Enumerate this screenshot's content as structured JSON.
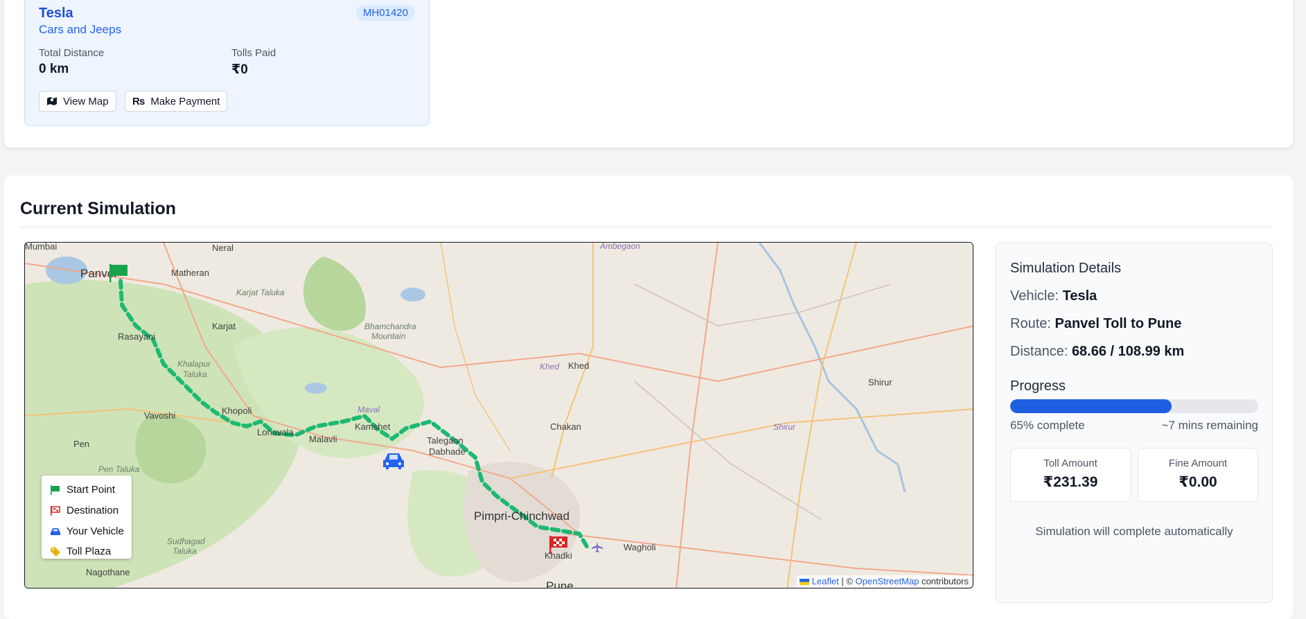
{
  "vehicle_card": {
    "name": "Tesla",
    "type": "Cars and Jeeps",
    "plate": "MH01420",
    "distance_label": "Total Distance",
    "distance_value": "0 km",
    "tolls_label": "Tolls Paid",
    "tolls_value": "₹0",
    "view_map_label": "View Map",
    "make_payment_label": "Make Payment",
    "payment_icon_text": "₨"
  },
  "simulation": {
    "title": "Current Simulation",
    "map": {
      "places": {
        "mumbai": "Mumbai",
        "panvel": "Panvel",
        "neral": "Neral",
        "matheran": "Matheran",
        "karjat_taluka": "Karjat Taluka",
        "karjat": "Karjat",
        "rasayani": "Rasayani",
        "bhamchandra": "Bhamchandra",
        "mountain": "Mountain",
        "khalapur": "Khalapur",
        "taluka": "Taluka",
        "vavoshi": "Vavoshi",
        "khopoli": "Khopoli",
        "lonavala": "Lonavala",
        "maval": "Maval",
        "malavli": "Malavli",
        "kamshet": "Kamshet",
        "talegaon": "Talegaon",
        "dabhade": "Dabhade",
        "pen": "Pen",
        "pen_taluka": "Pen Taluka",
        "sudhagad": "Sudhagad",
        "sudhagad_taluka": "Taluka",
        "nagothane": "Nagothane",
        "ambegaon": "Ambegaon",
        "khed_italic": "Khed",
        "khed": "Khed",
        "chakan": "Chakan",
        "shirur_italic": "Shirur",
        "shirur": "Shirur",
        "pimpri": "Pimpri-Chinchwad",
        "khadki": "Khadki",
        "wagholi": "Wagholi",
        "pune": "Pune"
      },
      "legend": {
        "start": "Start Point",
        "destination": "Destination",
        "vehicle": "Your Vehicle",
        "toll": "Toll Plaza"
      },
      "attribution": {
        "leaflet": "Leaflet",
        "sep": "| ©",
        "osm": "OpenStreetMap",
        "contributors": "contributors"
      },
      "colors": {
        "route": "#1db872",
        "start_flag": "#16a34a",
        "destination_flag": "#dc2626",
        "vehicle": "#2563eb",
        "toll": "#eab308"
      }
    },
    "details": {
      "title": "Simulation Details",
      "vehicle_label": "Vehicle:",
      "vehicle_value": "Tesla",
      "route_label": "Route:",
      "route_value": "Panvel Toll to Pune",
      "distance_label": "Distance:",
      "distance_value": "68.66 / 108.99 km",
      "progress_title": "Progress",
      "progress_percent": 65,
      "progress_text": "65% complete",
      "remaining_text": "~7 mins remaining",
      "toll_label": "Toll Amount",
      "toll_value": "₹231.39",
      "fine_label": "Fine Amount",
      "fine_value": "₹0.00",
      "footer": "Simulation will complete automatically"
    }
  }
}
